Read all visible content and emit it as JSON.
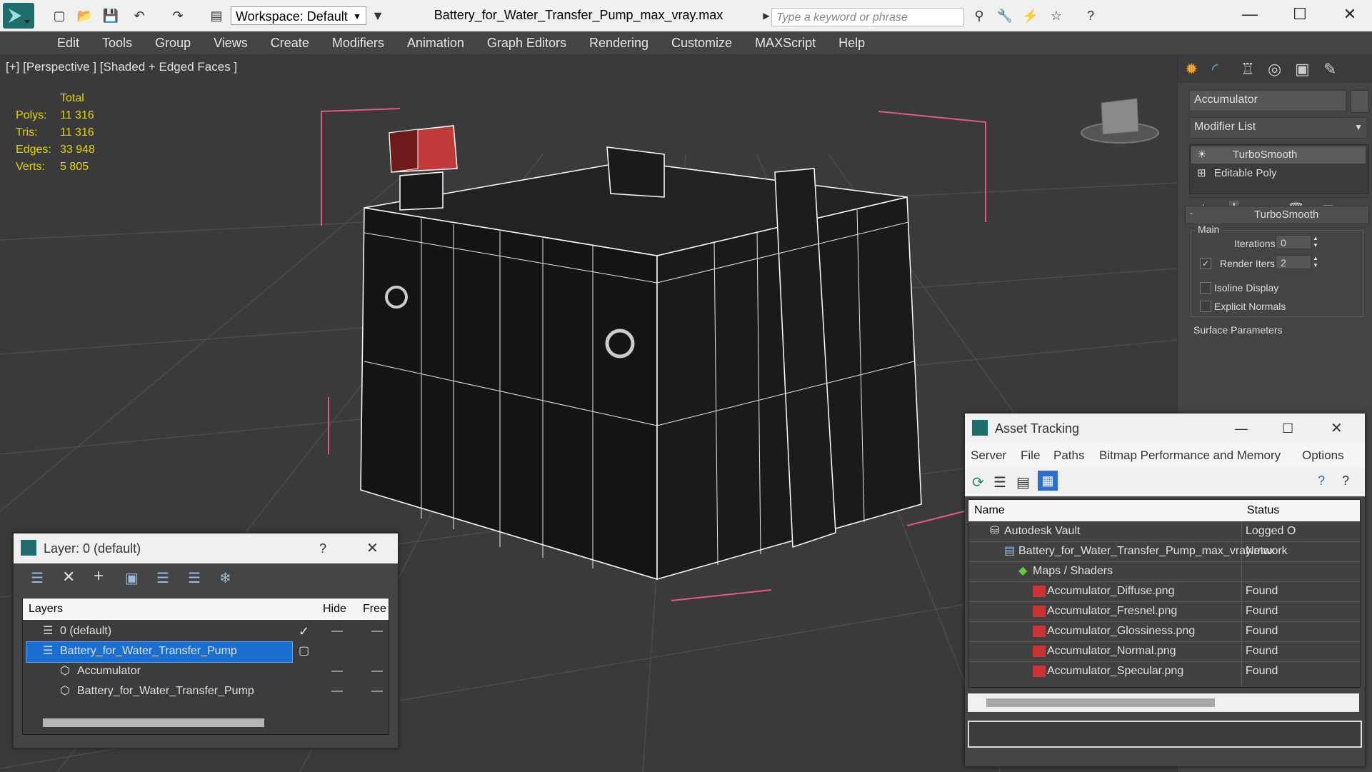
{
  "titlebar": {
    "workspace_label": "Workspace: Default",
    "document_title": "Battery_for_Water_Transfer_Pump_max_vray.max",
    "search_placeholder": "Type a keyword or phrase"
  },
  "menu": [
    "Edit",
    "Tools",
    "Group",
    "Views",
    "Create",
    "Modifiers",
    "Animation",
    "Graph Editors",
    "Rendering",
    "Customize",
    "MAXScript",
    "Help"
  ],
  "viewport": {
    "label": "[+] [Perspective ] [Shaded + Edged Faces ]",
    "stats_header": "Total",
    "stats": [
      {
        "label": "Polys:",
        "value": "11 316"
      },
      {
        "label": "Tris:",
        "value": "11 316"
      },
      {
        "label": "Edges:",
        "value": "33 948"
      },
      {
        "label": "Verts:",
        "value": "5 805"
      }
    ]
  },
  "command_panel": {
    "object_name": "Accumulator",
    "modifier_list": "Modifier List",
    "stack": [
      "TurboSmooth",
      "Editable Poly"
    ],
    "rollout_title": "TurboSmooth",
    "group_main": "Main",
    "iterations_label": "Iterations:",
    "iterations_value": "0",
    "render_iters_label": "Render Iters:",
    "render_iters_value": "2",
    "isoline_label": "Isoline Display",
    "explicit_normals_label": "Explicit Normals",
    "surface_params_label": "Surface Parameters"
  },
  "layer_panel": {
    "title": "Layer: 0 (default)",
    "help": "?",
    "columns": {
      "layers": "Layers",
      "hide": "Hide",
      "freeze": "Free"
    },
    "rows": [
      {
        "name": "0 (default)",
        "checked": true
      },
      {
        "name": "Battery_for_Water_Transfer_Pump",
        "selected": true
      },
      {
        "name": "Accumulator"
      },
      {
        "name": "Battery_for_Water_Transfer_Pump"
      }
    ]
  },
  "asset_panel": {
    "title": "Asset Tracking",
    "menu": [
      "Server",
      "File",
      "Paths",
      "Bitmap Performance and Memory",
      "Options"
    ],
    "columns": {
      "name": "Name",
      "status": "Status"
    },
    "rows": [
      {
        "name": "Autodesk Vault",
        "status": "Logged O"
      },
      {
        "name": "Battery_for_Water_Transfer_Pump_max_vray.max",
        "status": "Network"
      },
      {
        "name": "Maps / Shaders",
        "status": ""
      },
      {
        "name": "Accumulator_Diffuse.png",
        "status": "Found"
      },
      {
        "name": "Accumulator_Fresnel.png",
        "status": "Found"
      },
      {
        "name": "Accumulator_Glossiness.png",
        "status": "Found"
      },
      {
        "name": "Accumulator_Normal.png",
        "status": "Found"
      },
      {
        "name": "Accumulator_Specular.png",
        "status": "Found"
      }
    ]
  }
}
